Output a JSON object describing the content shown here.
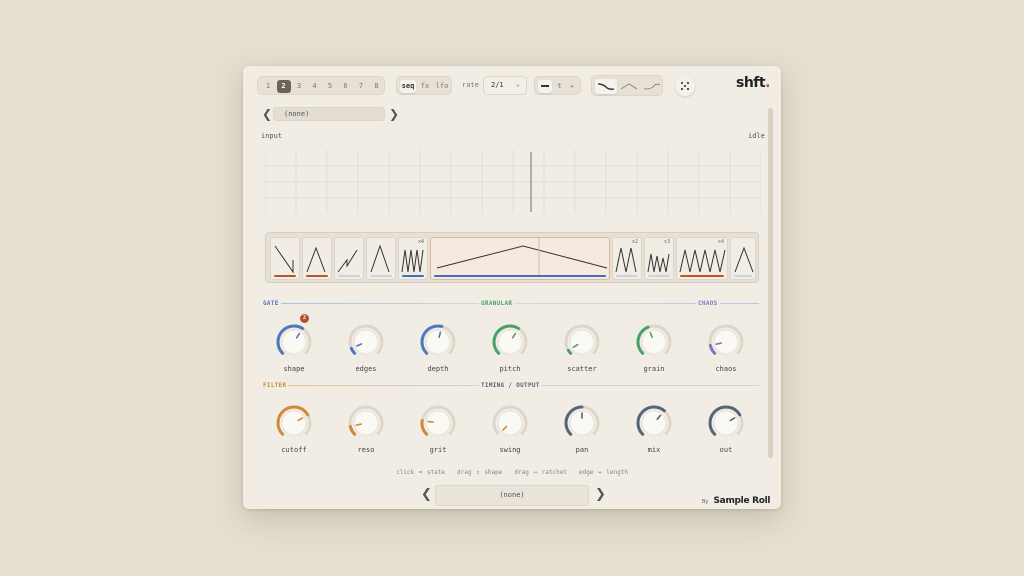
{
  "header": {
    "slots": [
      "1",
      "2",
      "3",
      "4",
      "5",
      "6",
      "7",
      "8"
    ],
    "active_slot": "2",
    "tabs": [
      "seq",
      "fx",
      "lfo"
    ],
    "active_tab": "seq",
    "rate_label": "rate",
    "rate_value": "2/1",
    "mode_t": "t",
    "mode_arrow": "▸",
    "logo": "shft",
    "logo_dot": "."
  },
  "preset_top": {
    "value": "(none)",
    "prev": "❮",
    "next": "❯"
  },
  "scope": {
    "input_label": "input",
    "status": "idle"
  },
  "pattern_strip": {
    "cells": [
      {
        "shape": "ramp-down",
        "bar": "#c0532a",
        "mult": ""
      },
      {
        "shape": "peak",
        "bar": "#c0532a",
        "mult": ""
      },
      {
        "shape": "saw-rise",
        "bar": "#c9d3df",
        "mult": ""
      },
      {
        "shape": "peak-tall",
        "bar": "#c9d3df",
        "mult": ""
      },
      {
        "shape": "zigzag",
        "bar": "#3d6fc0",
        "mult": "x4"
      },
      {
        "shape": "peak-wide",
        "bar": "#3d6fc0",
        "mult": ""
      },
      {
        "shape": "zigzag2",
        "bar": "#c9d3df",
        "mult": "x2"
      },
      {
        "shape": "zigzag3",
        "bar": "#c9d3df",
        "mult": "x3"
      },
      {
        "shape": "zigzag4",
        "bar": "#c0532a",
        "mult": "x4"
      },
      {
        "shape": "peak",
        "bar": "#c9d3df",
        "mult": ""
      }
    ]
  },
  "sections": {
    "gate": "GATE",
    "granular": "GRANULAR",
    "chaos": "CHAOS",
    "filter": "FILTER",
    "timing": "TIMING / OUTPUT"
  },
  "colors": {
    "gate": "#4a78c2",
    "granular": "#4aa06a",
    "chaos": "#8a6fc8",
    "filter": "#d08a3a",
    "timing": "#55657a",
    "accent": "#c0532a"
  },
  "knobs_row1": [
    {
      "label": "shape",
      "value": 0.62,
      "color": "#4a78c2",
      "badge": "2"
    },
    {
      "label": "edges",
      "value": 0.08,
      "color": "#4a78c2"
    },
    {
      "label": "depth",
      "value": 0.55,
      "color": "#4a78c2"
    },
    {
      "label": "pitch",
      "value": 0.62,
      "color": "#4aa06a"
    },
    {
      "label": "scatter",
      "value": 0.05,
      "color": "#4aa06a"
    },
    {
      "label": "grain",
      "value": 0.42,
      "color": "#4aa06a"
    },
    {
      "label": "chaos",
      "value": 0.12,
      "color": "#8a6fc8"
    }
  ],
  "knobs_row2": [
    {
      "label": "cutoff",
      "value": 0.72,
      "color": "#d08a3a"
    },
    {
      "label": "reso",
      "value": 0.12,
      "color": "#d08a3a"
    },
    {
      "label": "grit",
      "value": 0.2,
      "color": "#d08a3a"
    },
    {
      "label": "swing",
      "value": 0.0,
      "color": "#d08a3a"
    },
    {
      "label": "pan",
      "value": 0.5,
      "color": "#55657a"
    },
    {
      "label": "mix",
      "value": 0.65,
      "color": "#55657a"
    },
    {
      "label": "out",
      "value": 0.72,
      "color": "#55657a"
    }
  ],
  "hints": [
    "click = state",
    "drag ↕ shape",
    "drag ↔ ratchet",
    "edge ↔ length"
  ],
  "preset_bottom": {
    "value": "(none)",
    "prev": "❮",
    "next": "❯"
  },
  "brand": {
    "by": "By",
    "name": "Sample Roll"
  }
}
